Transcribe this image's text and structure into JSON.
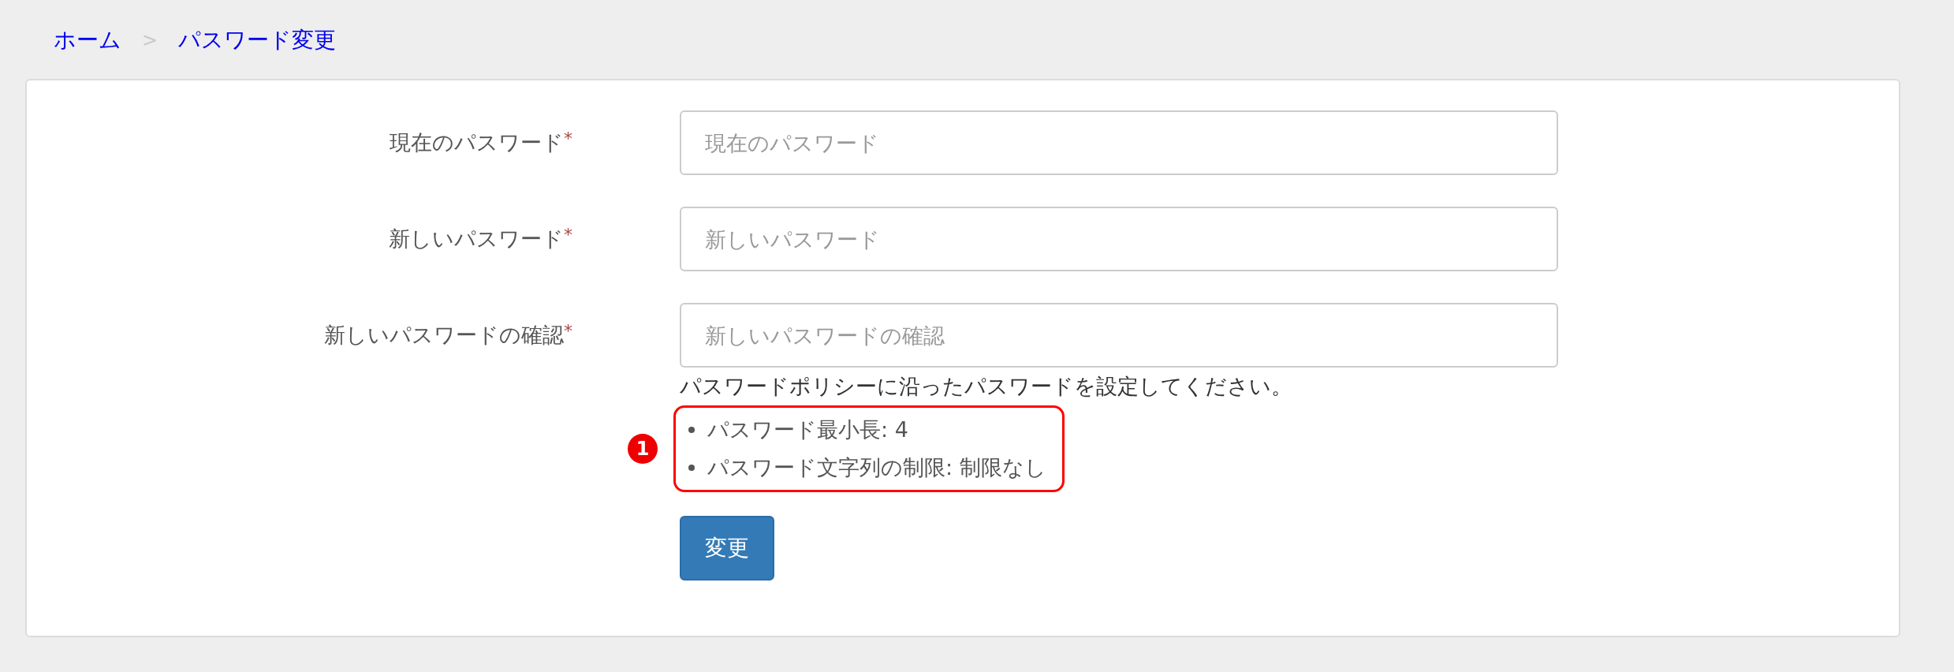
{
  "breadcrumb": [
    {
      "label": "ホーム"
    },
    {
      "label": "パスワード変更"
    }
  ],
  "breadcrumb_separator": ">",
  "form": {
    "fields": [
      {
        "label": "現在のパスワード",
        "required": true,
        "placeholder": "現在のパスワード"
      },
      {
        "label": "新しいパスワード",
        "required": true,
        "placeholder": "新しいパスワード"
      },
      {
        "label": "新しいパスワードの確認",
        "required": true,
        "placeholder": "新しいパスワードの確認"
      }
    ],
    "required_mark": "*",
    "help_text": "パスワードポリシーに沿ったパスワードを設定してください。",
    "policy": [
      "パスワード最小長: 4",
      "パスワード文字列の制限: 制限なし"
    ],
    "annotation": {
      "badge": "1"
    },
    "submit_button": "変更"
  }
}
